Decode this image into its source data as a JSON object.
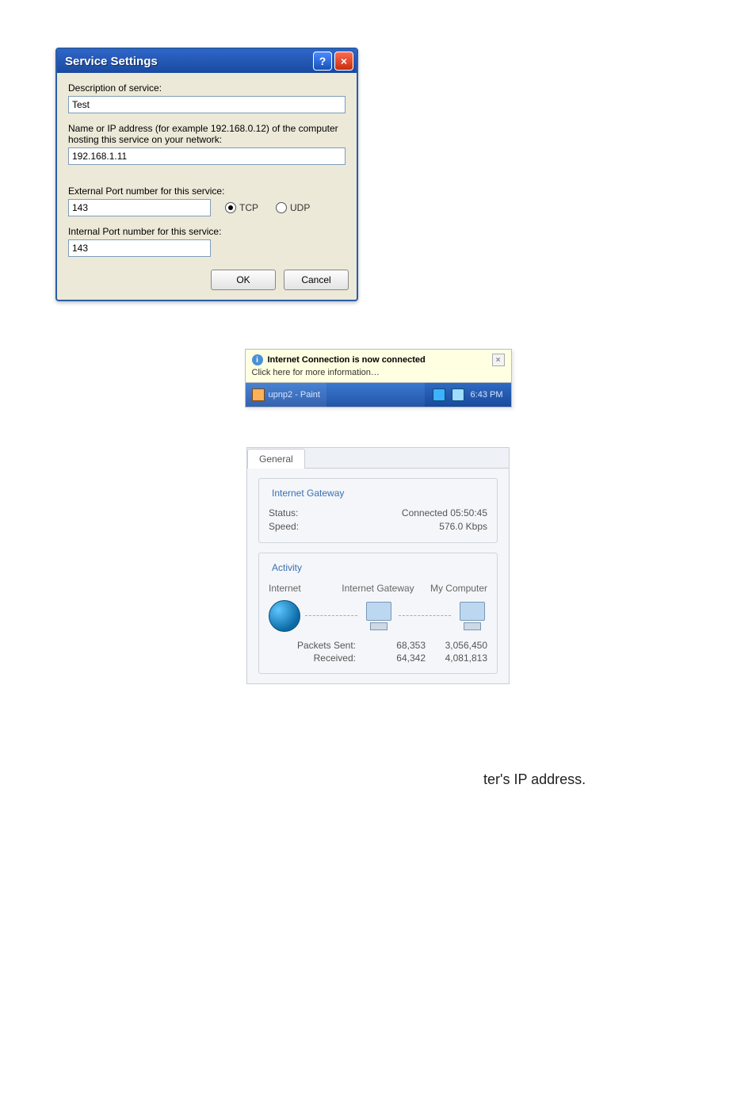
{
  "serviceDialog": {
    "title": "Service Settings",
    "helpBtn": "?",
    "closeBtn": "×",
    "descLabel": "Description of service:",
    "descValue": "Test",
    "hostLabel": "Name or IP address (for example 192.168.0.12) of the computer hosting this service on your network:",
    "hostValue": "192.168.1.11",
    "extPortLabel": "External Port number for this service:",
    "extPortValue": "143",
    "protoTCP": "TCP",
    "protoUDP": "UDP",
    "protoSelected": "TCP",
    "intPortLabel": "Internal Port number for this service:",
    "intPortValue": "143",
    "okLabel": "OK",
    "cancelLabel": "Cancel"
  },
  "balloon": {
    "title": "Internet Connection is now connected",
    "sub": "Click here for more information…",
    "closeGlyph": "×"
  },
  "taskbar": {
    "appName": "upnp2 - Paint",
    "time": "6:43 PM"
  },
  "statusPanel": {
    "tabLabel": "General",
    "gatewayGroup": "Internet Gateway",
    "statusLabel": "Status:",
    "statusValue": "Connected  05:50:45",
    "speedLabel": "Speed:",
    "speedValue": "576.0 Kbps",
    "activityGroup": "Activity",
    "headInternet": "Internet",
    "headGateway": "Internet Gateway",
    "headComputer": "My Computer",
    "pktSentLabel": "Packets Sent:",
    "pktRecvLabel": "Received:",
    "pktSentGw": "68,353",
    "pktSentMy": "3,056,450",
    "pktRecvGw": "64,342",
    "pktRecvMy": "4,081,813"
  },
  "strayText": "ter's IP address."
}
